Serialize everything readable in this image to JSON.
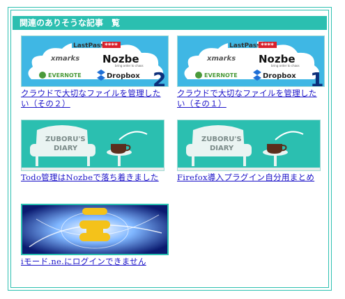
{
  "section": {
    "title": "関連のありそうな記事　覧"
  },
  "posts": [
    {
      "title": "クラウドで大切なファイルを管理したい（その２）",
      "thumb": {
        "badge": "2",
        "brands": [
          "LastPass",
          "xmarks",
          "Nozbe",
          "EVERNOTE",
          "Dropbox"
        ],
        "stars": "****",
        "sub": "bring order to chaos"
      }
    },
    {
      "title": "クラウドで大切なファイルを管理したい（その１）",
      "thumb": {
        "badge": "1",
        "brands": [
          "LastPass",
          "xmarks",
          "Nozbe",
          "EVERNOTE",
          "Dropbox"
        ],
        "stars": "****",
        "sub": "bring order to chaos"
      }
    },
    {
      "title": "Todo管理はNozbeで落ち着きました",
      "thumb": {
        "line1": "ZUBORU'S",
        "line2": "DIARY"
      }
    },
    {
      "title": "Firefox導入プラグイン自分用まとめ",
      "thumb": {
        "line1": "ZUBORU'S",
        "line2": "DIARY"
      }
    },
    {
      "title": "iモード.ne.にログインできません"
    }
  ],
  "colors": {
    "accent": "#2bbfb0",
    "link": "#1a12c8",
    "sky": "#3fb7e4",
    "teal": "#2bbfb0"
  }
}
